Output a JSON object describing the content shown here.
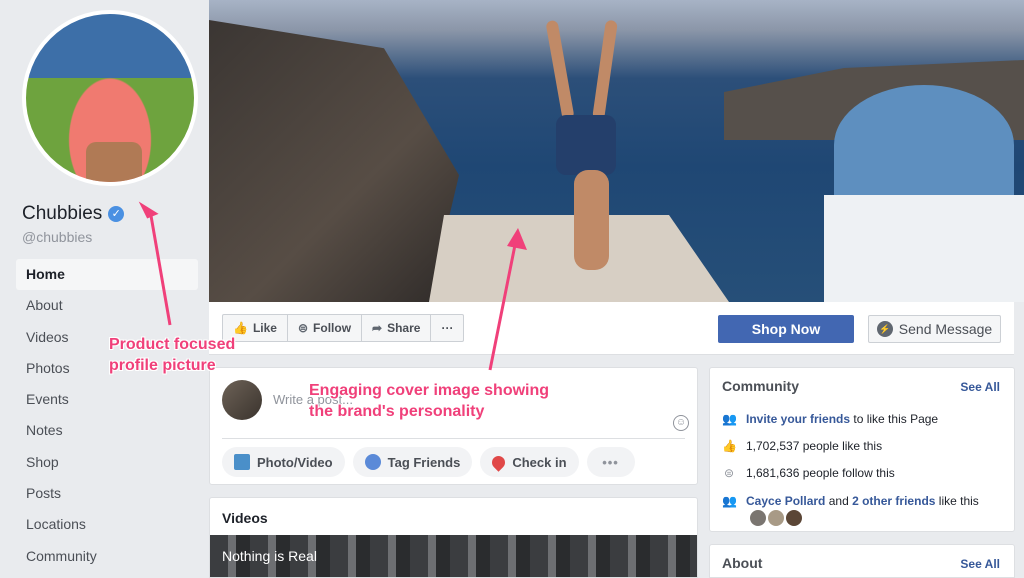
{
  "page": {
    "name": "Chubbies",
    "handle": "@chubbies",
    "verified_mark": "✓"
  },
  "sidebar": {
    "items": [
      {
        "label": "Home",
        "active": true
      },
      {
        "label": "About"
      },
      {
        "label": "Videos"
      },
      {
        "label": "Photos"
      },
      {
        "label": "Events"
      },
      {
        "label": "Notes"
      },
      {
        "label": "Shop"
      },
      {
        "label": "Posts"
      },
      {
        "label": "Locations"
      },
      {
        "label": "Community"
      }
    ]
  },
  "actions": {
    "like": "Like",
    "follow": "Follow",
    "share": "Share",
    "more": "···",
    "shop_now": "Shop Now",
    "send_message": "Send Message"
  },
  "composer": {
    "placeholder": "Write a post...",
    "photo_video": "Photo/Video",
    "tag_friends": "Tag Friends",
    "check_in": "Check in",
    "more": "•••"
  },
  "videos": {
    "title": "Videos",
    "video_title": "Nothing is Real"
  },
  "community": {
    "title": "Community",
    "see_all": "See All",
    "invite_link": "Invite your friends",
    "invite_rest": "to like this Page",
    "likes": "1,702,537 people like this",
    "follows": "1,681,636 people follow this",
    "friend_name": "Cayce Pollard",
    "friend_and": "and",
    "friend_others": "2 other friends",
    "friend_rest": "like this"
  },
  "about": {
    "title": "About",
    "see_all": "See All"
  },
  "annotations": {
    "profile_line1": "Product focused",
    "profile_line2": "profile picture",
    "cover_line1": "Engaging cover image showing",
    "cover_line2": "the brand's personality"
  },
  "colors": {
    "brand_blue": "#4267b2",
    "link_blue": "#365899",
    "annotation_pink": "#f0407a",
    "page_bg": "#e9ebee"
  },
  "icons": {
    "like": "thumbs-up-icon",
    "follow": "rss-icon",
    "share": "share-arrow-icon",
    "messenger": "messenger-icon",
    "emoji": "smiley-icon"
  }
}
